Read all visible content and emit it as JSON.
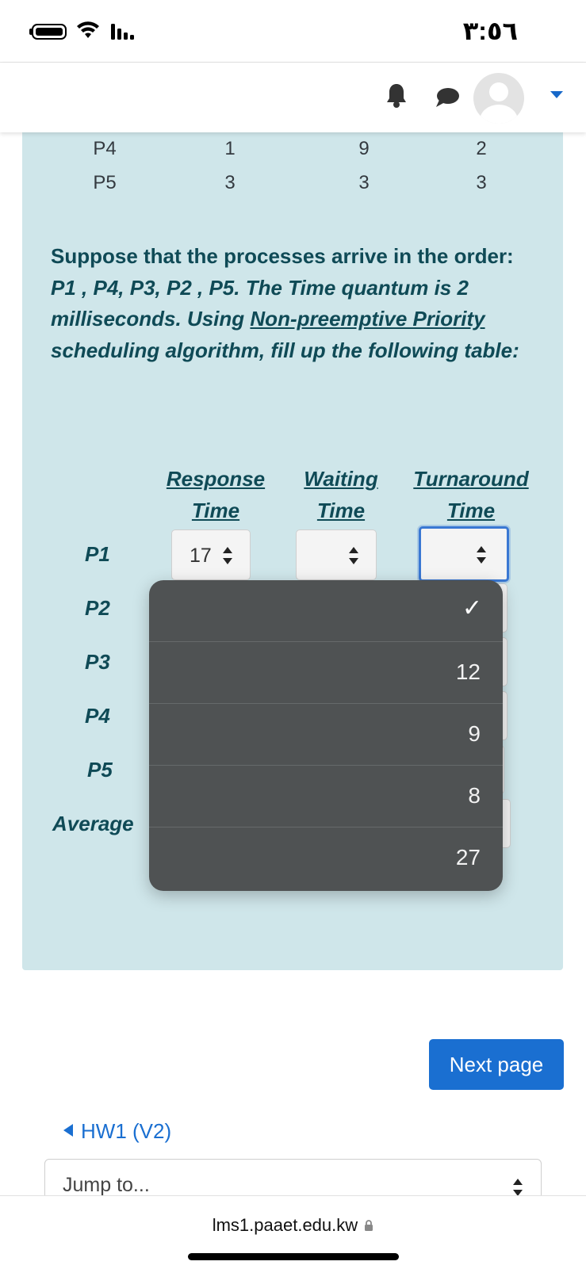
{
  "status_bar": {
    "time": "٣:٥٦"
  },
  "table_top": {
    "rows": [
      {
        "process": "P4",
        "c1": "1",
        "c2": "9",
        "c3": "2"
      },
      {
        "process": "P5",
        "c1": "3",
        "c2": "3",
        "c3": "3"
      }
    ]
  },
  "question": {
    "part1": "Suppose that the processes arrive in the order: ",
    "part2": "P1 , P4, P3, P2 , P5. The Time quantum is 2 milliseconds. Using ",
    "link": "Non-preemptive Priority",
    "part3": " scheduling algorithm, fill up the following table:"
  },
  "answer_table": {
    "headers": [
      {
        "line1": "Response",
        "line2": "Time"
      },
      {
        "line1": "Waiting",
        "line2": "Time"
      },
      {
        "line1": "Turnaround",
        "line2": "Time"
      }
    ],
    "rows": [
      "P1",
      "P2",
      "P3",
      "P4",
      "P5",
      "Average"
    ],
    "p1_response_value": "17"
  },
  "dropdown": {
    "options": [
      "",
      "12",
      "9",
      "8",
      "27"
    ],
    "selected_index": 0
  },
  "next_button": "Next page",
  "prev_link": "HW1 (V2)",
  "jump_to": "Jump to...",
  "url": "lms1.paaet.edu.kw"
}
